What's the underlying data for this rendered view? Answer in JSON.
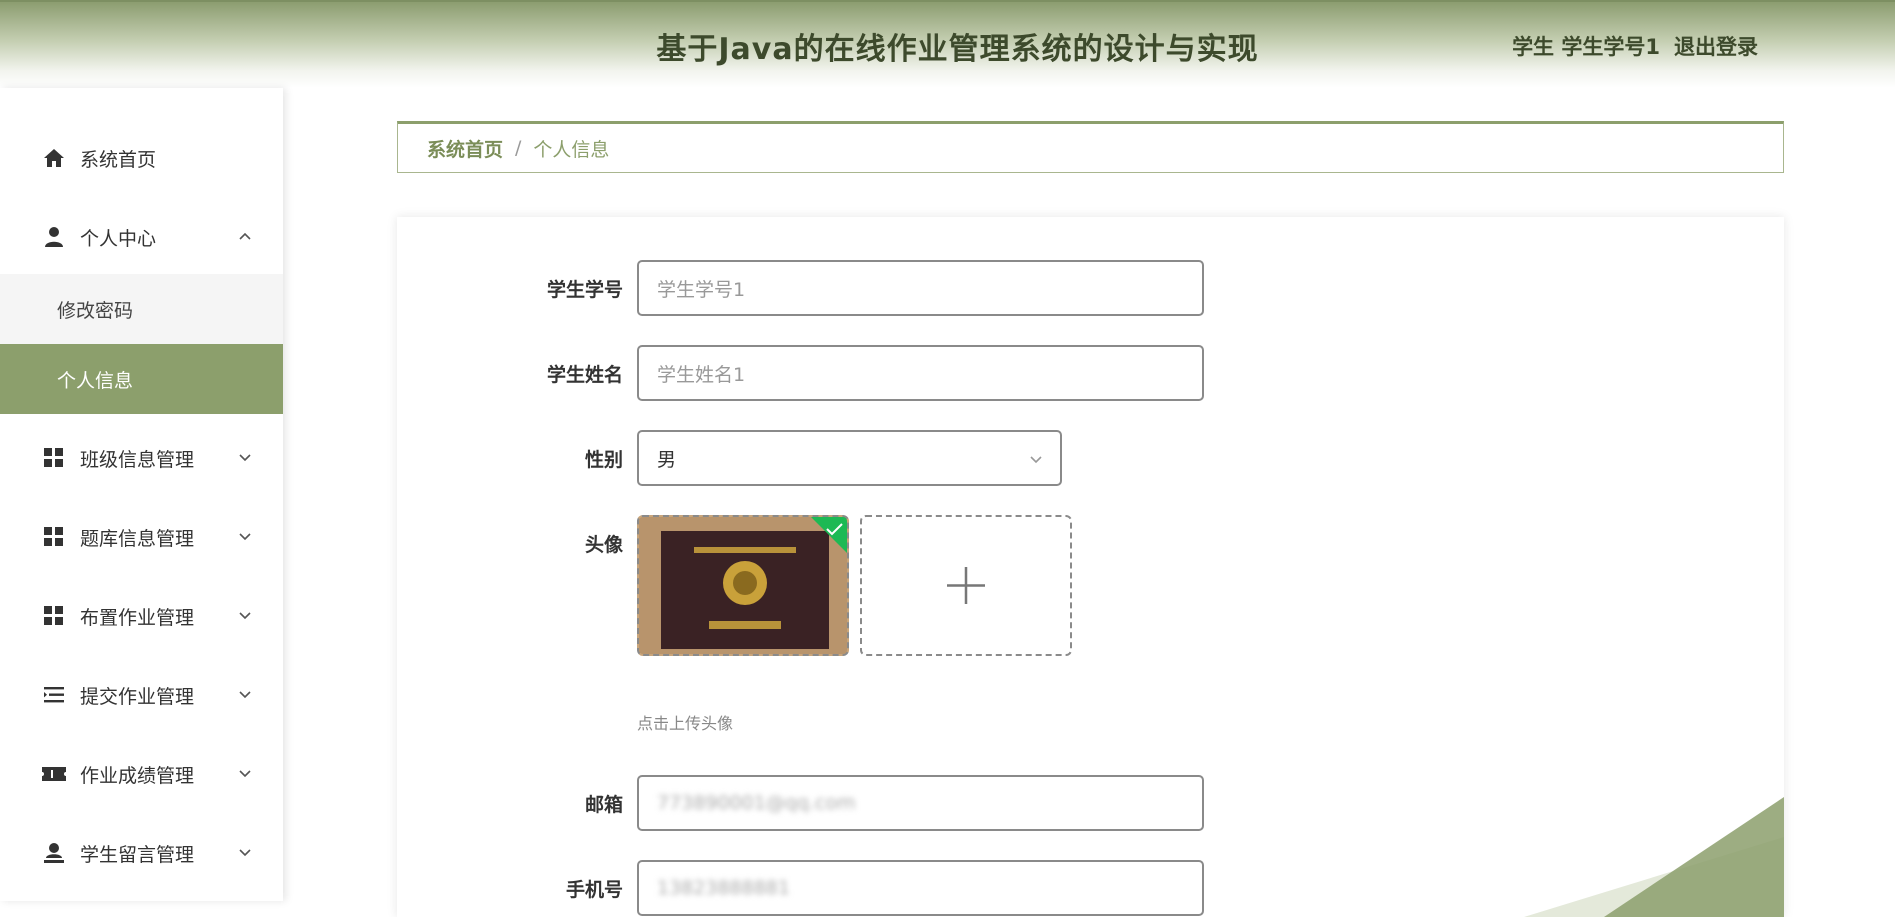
{
  "header": {
    "title": "基于Java的在线作业管理系统的设计与实现",
    "user_label": "学生 学生学号1",
    "logout_label": "退出登录"
  },
  "sidebar": {
    "items": [
      {
        "label": "系统首页",
        "icon": "home-icon"
      },
      {
        "label": "个人中心",
        "icon": "user-icon",
        "expanded": true
      },
      {
        "label": "修改密码"
      },
      {
        "label": "个人信息",
        "active": true
      },
      {
        "label": "班级信息管理",
        "icon": "grid-icon"
      },
      {
        "label": "题库信息管理",
        "icon": "grid-icon"
      },
      {
        "label": "布置作业管理",
        "icon": "grid-icon"
      },
      {
        "label": "提交作业管理",
        "icon": "list-icon"
      },
      {
        "label": "作业成绩管理",
        "icon": "ticket-icon"
      },
      {
        "label": "学生留言管理",
        "icon": "user-stand-icon"
      }
    ]
  },
  "breadcrumb": {
    "home": "系统首页",
    "separator": "/",
    "current": "个人信息"
  },
  "form": {
    "student_no": {
      "label": "学生学号",
      "value": "学生学号1"
    },
    "student_name": {
      "label": "学生姓名",
      "value": "学生姓名1"
    },
    "gender": {
      "label": "性别",
      "value": "男"
    },
    "avatar": {
      "label": "头像",
      "hint": "点击上传头像"
    },
    "email": {
      "label": "邮箱",
      "value": "773890001@qq.com"
    },
    "phone": {
      "label": "手机号",
      "value": "13823888881"
    }
  },
  "colors": {
    "accent": "#8c9f6c",
    "header_dark": "#3d4a2c"
  }
}
